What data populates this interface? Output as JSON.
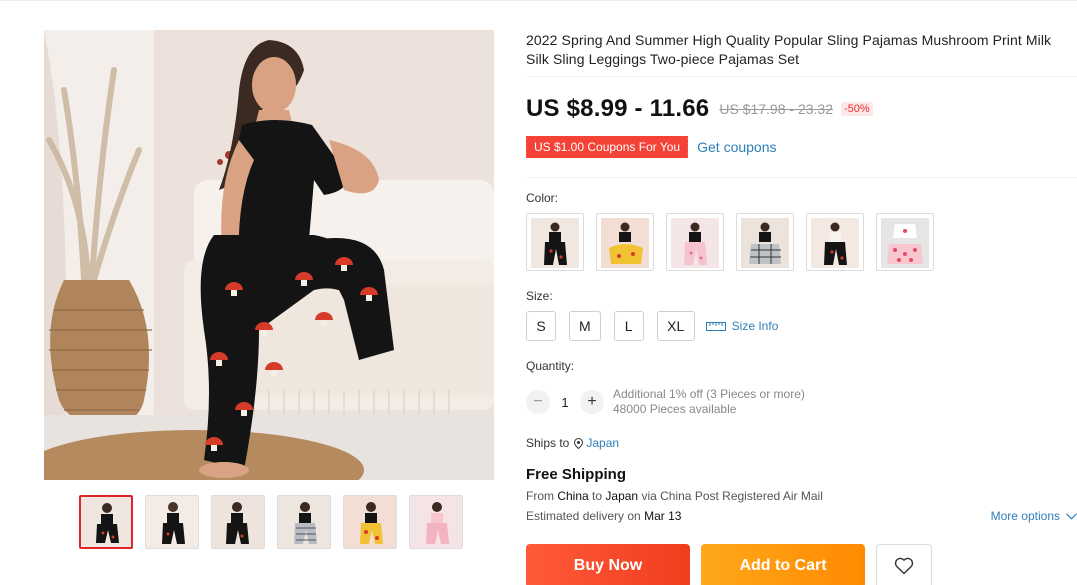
{
  "product": {
    "title": "2022 Spring And Summer High Quality Popular Sling Pajamas Mushroom Print Milk Silk Sling Leggings Two-piece Pajamas Set",
    "price": "US $8.99 - 11.66",
    "old_price": "US $17.98 - 23.32",
    "discount": "-50%"
  },
  "coupon": {
    "badge": "US $1.00 Coupons For You",
    "link": "Get coupons"
  },
  "color": {
    "label": "Color:",
    "options": [
      "black-mushroom",
      "black-yellow",
      "pink-print",
      "black-plaid",
      "black-mushroom-2",
      "white-pink-strawberry"
    ]
  },
  "size": {
    "label": "Size:",
    "options": [
      "S",
      "M",
      "L",
      "XL"
    ],
    "info": "Size Info"
  },
  "quantity": {
    "label": "Quantity:",
    "value": "1",
    "minus": "−",
    "plus": "+",
    "offer": "Additional 1% off (3 Pieces or more)",
    "available": "48000 Pieces available"
  },
  "shipping": {
    "ships_to_label": "Ships to",
    "country": "Japan",
    "free": "Free Shipping",
    "from_prefix": "From",
    "from_country": "China",
    "to_word": "to",
    "to_country": "Japan",
    "via": "via China Post Registered Air Mail",
    "est_prefix": "Estimated delivery on",
    "est_date": "Mar 13",
    "more_options": "More options"
  },
  "actions": {
    "buy_now": "Buy Now",
    "add_to_cart": "Add to Cart"
  },
  "colors": {
    "accent_red": "#f44336",
    "link_blue": "#2e7fb7",
    "buy_orange": "#f03d1e",
    "cart_orange": "#ff8a00",
    "thumb_active_border": "#e0262b"
  }
}
